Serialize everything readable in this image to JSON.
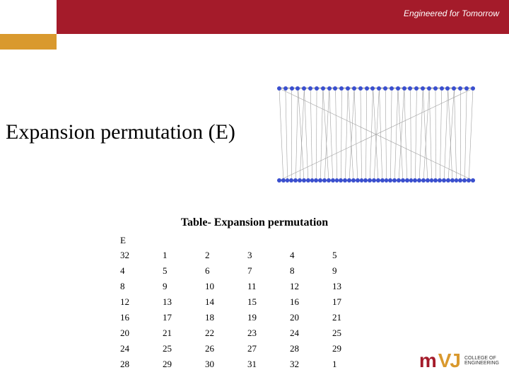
{
  "header": {
    "tagline": "Engineered for Tomorrow"
  },
  "title": "Expansion permutation (E)",
  "table": {
    "caption": "Table- Expansion permutation",
    "label": "E",
    "rows": [
      [
        32,
        1,
        2,
        3,
        4,
        5
      ],
      [
        4,
        5,
        6,
        7,
        8,
        9
      ],
      [
        8,
        9,
        10,
        11,
        12,
        13
      ],
      [
        12,
        13,
        14,
        15,
        16,
        17
      ],
      [
        16,
        17,
        18,
        19,
        20,
        21
      ],
      [
        20,
        21,
        22,
        23,
        24,
        25
      ],
      [
        24,
        25,
        26,
        27,
        28,
        29
      ],
      [
        28,
        29,
        30,
        31,
        32,
        1
      ]
    ]
  },
  "diagram": {
    "top_nodes": 32,
    "bottom_nodes": 48,
    "description": "expansion-permutation-wiring"
  },
  "logo": {
    "m": "m",
    "vj": "VJ",
    "line1": "COLLEGE OF",
    "line2": "ENGINEERING"
  }
}
